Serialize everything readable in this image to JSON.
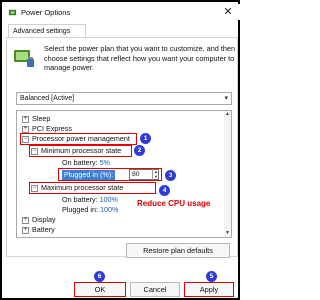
{
  "window": {
    "title": "Power Options",
    "tab": "Advanced settings",
    "description": "Select the power plan that you want to customize, and then choose settings that reflect how you want your computer to manage power."
  },
  "plan_select": {
    "value": "Balanced [Active]"
  },
  "tree": {
    "items": [
      {
        "label": "Sleep"
      },
      {
        "label": "PCI Express"
      },
      {
        "label": "Processor power management"
      },
      {
        "label": "Minimum processor state"
      },
      {
        "label": "On battery:",
        "value": "5%"
      },
      {
        "label": "Plugged in (%):",
        "value": "80"
      },
      {
        "label": "Maximum processor state"
      },
      {
        "label": "On battery:",
        "value": "100%"
      },
      {
        "label": "Plugged in:",
        "value": "100%"
      },
      {
        "label": "Display"
      },
      {
        "label": "Battery"
      }
    ]
  },
  "annotation": {
    "text": "Reduce CPU usage"
  },
  "badges": [
    "1",
    "2",
    "3",
    "4",
    "5",
    "6"
  ],
  "buttons": {
    "restore": "Restore plan defaults",
    "ok": "OK",
    "cancel": "Cancel",
    "apply": "Apply"
  },
  "colors": {
    "annotation_red": "#e00000",
    "badge_blue": "#2f3bd6",
    "value_blue": "#1a5fb4"
  }
}
